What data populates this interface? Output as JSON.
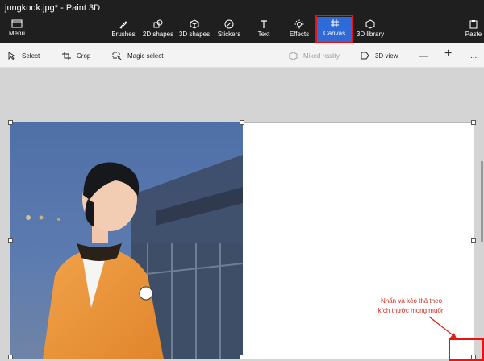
{
  "window": {
    "title": "jungkook.jpg* - Paint 3D"
  },
  "ribbon": {
    "menu_label": "Menu",
    "tools": [
      {
        "label": "Brushes"
      },
      {
        "label": "2D shapes"
      },
      {
        "label": "3D shapes"
      },
      {
        "label": "Stickers"
      },
      {
        "label": "Text"
      },
      {
        "label": "Effects"
      },
      {
        "label": "Canvas"
      },
      {
        "label": "3D library"
      }
    ],
    "paste_label": "Paste",
    "active_tool": "Canvas",
    "active_color": "#2f6bd6"
  },
  "subtoolbar": {
    "select_label": "Select",
    "crop_label": "Crop",
    "magic_select_label": "Magic select",
    "mixed_reality_label": "Mixed reality",
    "view3d_label": "3D view",
    "zoom_out_symbol": "—",
    "zoom_in_symbol": "+",
    "more_symbol": "..."
  },
  "annotation": {
    "line1": "Nhấn và kéo thả theo",
    "line2": "kích thước mong muốn",
    "color": "#d12a1a"
  }
}
